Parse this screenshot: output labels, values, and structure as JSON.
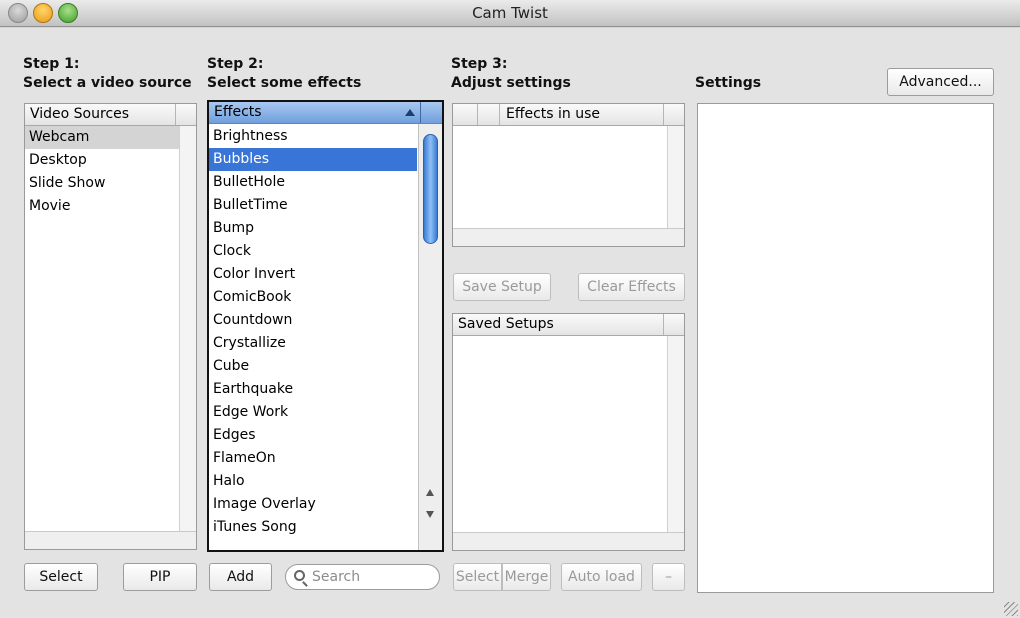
{
  "window": {
    "title": "Cam Twist"
  },
  "step1": {
    "line1": "Step 1:",
    "line2": "Select a video source"
  },
  "step2": {
    "line1": "Step 2:",
    "line2": "Select some effects"
  },
  "step3": {
    "line1": "Step 3:",
    "line2": "Adjust settings"
  },
  "settings": {
    "label": "Settings",
    "advanced_button": "Advanced..."
  },
  "sources": {
    "header": "Video Sources",
    "items": [
      "Webcam",
      "Desktop",
      "Slide Show",
      "Movie"
    ],
    "selected": "Webcam"
  },
  "effects": {
    "header": "Effects",
    "items": [
      "Brightness",
      "Bubbles",
      "BulletHole",
      "BulletTime",
      "Bump",
      "Clock",
      "Color Invert",
      "ComicBook",
      "Countdown",
      "Crystallize",
      "Cube",
      "Earthquake",
      "Edge Work",
      "Edges",
      "FlameOn",
      "Halo",
      "Image Overlay",
      "iTunes Song"
    ],
    "selected": "Bubbles"
  },
  "effects_in_use": {
    "header": "Effects in use"
  },
  "buttons": {
    "save_setup": "Save Setup",
    "clear_effects": "Clear Effects",
    "select_source": "Select",
    "pip": "PIP",
    "add": "Add",
    "select_setup": "Select",
    "merge": "Merge",
    "auto_load": "Auto load",
    "remove": "–"
  },
  "saved_setups": {
    "header": "Saved Setups"
  },
  "search": {
    "placeholder": "Search"
  },
  "colors": {
    "selection_blue": "#3875d7",
    "header_blue": "#6f9fdd"
  }
}
